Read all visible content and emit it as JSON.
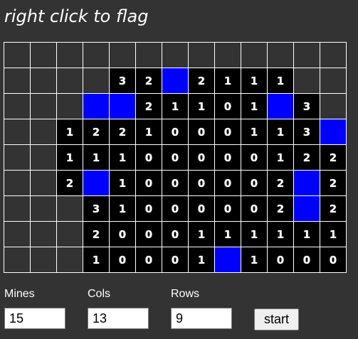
{
  "title": "right click to flag",
  "colors": {
    "background": "#333333",
    "open_cell": "#000000",
    "flag_cell": "#0000ff",
    "hidden_cell": "#333333",
    "grid_line": "#ffffff"
  },
  "board": {
    "legend": {
      "H": "hidden",
      "F": "flagged",
      "digits": "revealed count"
    },
    "rows": [
      [
        "H",
        "H",
        "H",
        "H",
        "H",
        "H",
        "H",
        "H",
        "H",
        "H",
        "H",
        "H",
        "H"
      ],
      [
        "H",
        "H",
        "H",
        "H",
        "3",
        "2",
        "F",
        "2",
        "1",
        "1",
        "1",
        "H",
        "H"
      ],
      [
        "H",
        "H",
        "H",
        "F",
        "F",
        "2",
        "1",
        "1",
        "0",
        "1",
        "F",
        "3",
        "H"
      ],
      [
        "H",
        "H",
        "1",
        "2",
        "2",
        "1",
        "0",
        "0",
        "0",
        "1",
        "1",
        "3",
        "F"
      ],
      [
        "H",
        "H",
        "1",
        "1",
        "1",
        "0",
        "0",
        "0",
        "0",
        "0",
        "1",
        "2",
        "2"
      ],
      [
        "H",
        "H",
        "2",
        "F",
        "1",
        "0",
        "0",
        "0",
        "0",
        "0",
        "2",
        "F",
        "2"
      ],
      [
        "H",
        "H",
        "H",
        "3",
        "1",
        "0",
        "0",
        "0",
        "0",
        "0",
        "2",
        "F",
        "2"
      ],
      [
        "H",
        "H",
        "H",
        "2",
        "0",
        "0",
        "0",
        "1",
        "1",
        "1",
        "1",
        "1",
        "1"
      ],
      [
        "H",
        "H",
        "H",
        "1",
        "0",
        "0",
        "0",
        "1",
        "F",
        "1",
        "0",
        "0",
        "0"
      ]
    ]
  },
  "controls": {
    "mines_label": "Mines",
    "mines_value": "15",
    "cols_label": "Cols",
    "cols_value": "13",
    "rows_label": "Rows",
    "rows_value": "9",
    "start_label": "start"
  }
}
